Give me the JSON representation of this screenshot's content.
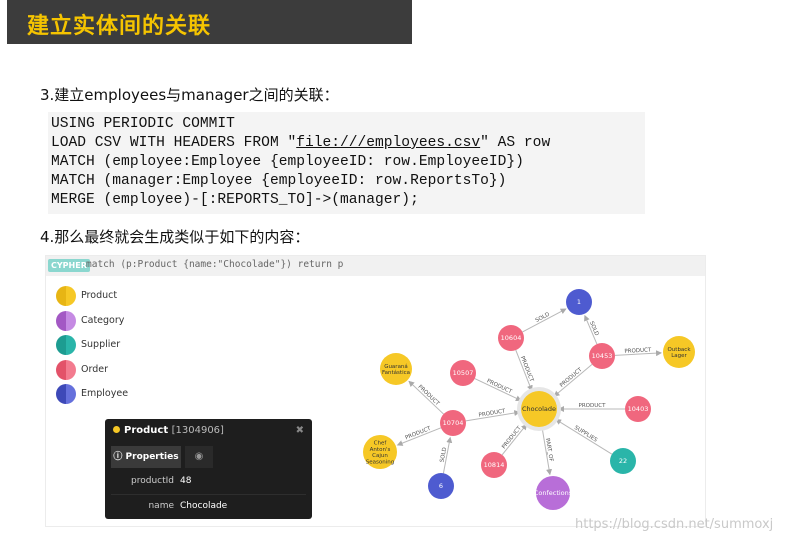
{
  "header": {
    "title": "建立实体间的关联"
  },
  "step3": {
    "text": "3.建立employees与manager之间的关联："
  },
  "code": {
    "line1": "USING PERIODIC COMMIT",
    "line2_prefix": "LOAD CSV WITH HEADERS FROM \"",
    "line2_link": "file:///employees.csv",
    "line2_suffix": "\" AS row",
    "line3": "MATCH (employee:Employee {employeeID: row.EmployeeID})",
    "line4": "MATCH (manager:Employee {employeeID: row.ReportsTo})",
    "line5": "MERGE (employee)-[:REPORTS_TO]->(manager);"
  },
  "step4": {
    "text": "4.那么最终就会生成类似于如下的内容："
  },
  "browser": {
    "badge": "CYPHER",
    "query": "match (p:Product {name:\"Chocolade\"}) return p",
    "legend": [
      {
        "label": "Product",
        "color": "#f6c826"
      },
      {
        "label": "Category",
        "color": "#b86ed8"
      },
      {
        "label": "Supplier",
        "color": "#2ab5a9"
      },
      {
        "label": "Order",
        "color": "#f0677e"
      },
      {
        "label": "Employee",
        "color": "#4e5bd0"
      }
    ],
    "panel": {
      "title": "Product",
      "id": "[1304906]",
      "close": "✖",
      "tab_properties": "Properties",
      "props": [
        {
          "key": "productId",
          "value": "48"
        },
        {
          "key": "name",
          "value": "Chocolade"
        }
      ]
    },
    "graph": {
      "nodes": [
        {
          "id": "chocolade",
          "label": "Chocolade",
          "color": "#f6c826"
        },
        {
          "id": "n1",
          "label": "1",
          "color": "#4e5bd0"
        },
        {
          "id": "n10604",
          "label": "10604",
          "color": "#f0677e"
        },
        {
          "id": "n10453",
          "label": "10453",
          "color": "#f0677e"
        },
        {
          "id": "outback",
          "label": "Outback Lager",
          "color": "#f6c826"
        },
        {
          "id": "n10507",
          "label": "10507",
          "color": "#f0677e"
        },
        {
          "id": "guarana",
          "label": "Guaraná Fantástica",
          "color": "#f6c826"
        },
        {
          "id": "n10704",
          "label": "10704",
          "color": "#f0677e"
        },
        {
          "id": "n10403",
          "label": "10403",
          "color": "#f0677e"
        },
        {
          "id": "chef",
          "label": "Chef Anton's Cajun Seasoning",
          "color": "#f6c826"
        },
        {
          "id": "n10814",
          "label": "10814",
          "color": "#f0677e"
        },
        {
          "id": "n22",
          "label": "22",
          "color": "#2ab5a9"
        },
        {
          "id": "n6",
          "label": "6",
          "color": "#4e5bd0"
        },
        {
          "id": "confections",
          "label": "Confections",
          "color": "#b86ed8"
        }
      ],
      "edges": [
        {
          "label": "SOLD"
        },
        {
          "label": "SOLD"
        },
        {
          "label": "PRODUCT"
        },
        {
          "label": "PRODUCT"
        },
        {
          "label": "PRODUCT"
        },
        {
          "label": "PRODUCT"
        },
        {
          "label": "PRODUCT"
        },
        {
          "label": "PRODUCT"
        },
        {
          "label": "PRODUCT"
        },
        {
          "label": "PRODUCT"
        },
        {
          "label": "PRODUCT"
        },
        {
          "label": "SUPPLIES"
        },
        {
          "label": "PART_OF"
        },
        {
          "label": "SOLD"
        }
      ]
    }
  },
  "watermark": "https://blog.csdn.net/summoxj"
}
